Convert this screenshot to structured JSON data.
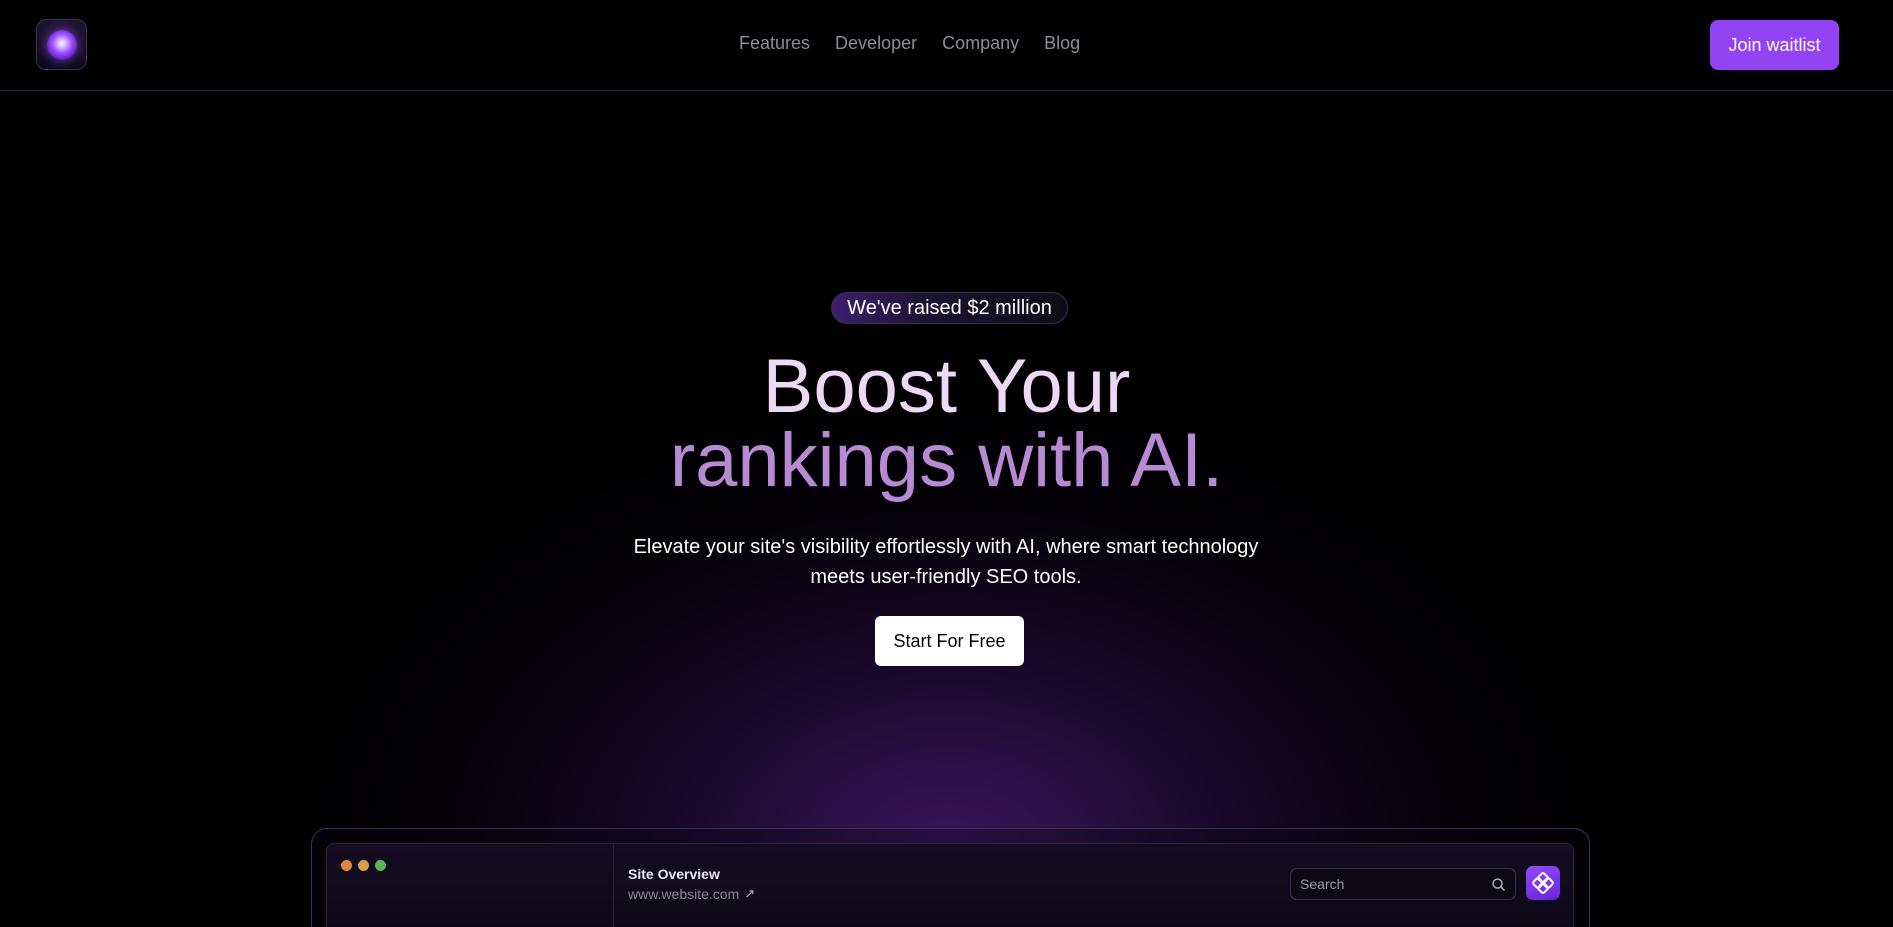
{
  "nav": {
    "links": [
      "Features",
      "Developer",
      "Company",
      "Blog"
    ],
    "cta_label": "Join waitlist"
  },
  "hero": {
    "badge": "We've raised $2 million",
    "title_line1": "Boost Your",
    "title_line2": "rankings with AI.",
    "subtitle": "Elevate your site's visibility effortlessly with AI, where smart technology meets user-friendly SEO tools.",
    "cta_label": "Start For Free"
  },
  "dashboard": {
    "title": "Site Overview",
    "url": "www.website.com",
    "search_placeholder": "Search",
    "window_dots": [
      "red",
      "yellow",
      "green"
    ]
  },
  "colors": {
    "accent": "#9343f3",
    "title_line1": "#ecd9f5",
    "title_line2": "#b88ad3",
    "background": "#000000"
  },
  "icons": {
    "logo": "orb-logo-icon",
    "external_link": "arrow-up-right-icon",
    "search": "search-icon",
    "app": "app-logo-icon"
  }
}
